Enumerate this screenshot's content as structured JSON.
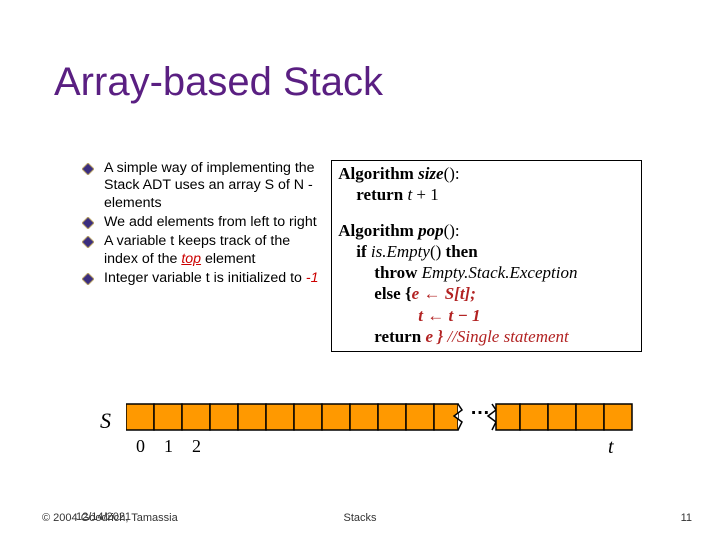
{
  "title": "Array-based Stack",
  "bullets": [
    "A simple way of implementing the Stack ADT uses an array S of N -elements",
    "We add elements from left to right",
    "A variable t keeps track of the index of the ",
    "Integer variable t is initialized to "
  ],
  "bullet2_suffix_top": "top",
  "bullet2_suffix_element": " element",
  "bullet3_suffix_neg1": "-1",
  "algo": {
    "size": {
      "head_kw": "Algorithm ",
      "head_fn": "size",
      "head_paren": "():",
      "ret_kw": "return ",
      "ret_var": "t",
      "ret_rest": " + 1"
    },
    "pop": {
      "head_kw": "Algorithm ",
      "head_fn": "pop",
      "head_paren": "():",
      "if_kw": "if ",
      "if_fn": "is.Empty",
      "if_rest": "() ",
      "if_then": "then",
      "throw_kw": "throw ",
      "throw_ex": "Empty.Stack.Exception",
      "else_kw": "else {",
      "else_expr_e": "e ",
      "arrow": "←",
      "else_expr_St": " S[t];",
      "line_t": "t ",
      "line_t_rhs": " t − 1",
      "ret_kw": "return ",
      "ret_expr": "e }",
      "ret_cmt": " //Single statement"
    }
  },
  "diagram": {
    "S": "S",
    "dots": "…",
    "idx0": "0",
    "idx1": "1",
    "idx2": "2",
    "t": "t"
  },
  "footer": {
    "copyright": "© 2004 Goodrich, Tamassia",
    "date": "12/14/2021",
    "center": "Stacks",
    "page": "11"
  }
}
